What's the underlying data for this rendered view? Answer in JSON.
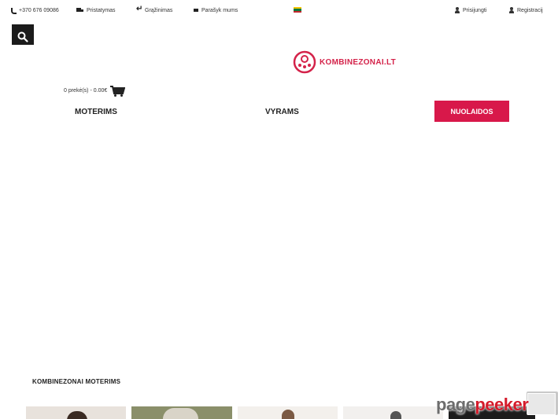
{
  "topbar": {
    "phone": "+370 676 09086",
    "delivery": "Pristatymas",
    "returns": "Grąžinimas",
    "contact": "Parašyk mums",
    "login": "Prisijungti",
    "register": "Registracij"
  },
  "header": {
    "logo_text": "KOMBINEZONAI.LT",
    "cart_text": "0 prekė(s) - 0.00€"
  },
  "nav": {
    "women": "MOTERIMS",
    "men": "VYRAMS",
    "sale": "NUOLAIDOS"
  },
  "section": {
    "title": "KOMBINEZONAI MOTERIMS"
  },
  "watermark": {
    "part1": "page",
    "part2": "peeker"
  },
  "colors": {
    "accent": "#d8184a",
    "brand": "#d4234a",
    "dark": "#1b1b1b"
  },
  "icons": [
    "phone-icon",
    "truck-icon",
    "return-icon",
    "mail-icon",
    "flag-icon",
    "user-icon",
    "user-plus-icon",
    "search-icon",
    "cart-icon"
  ]
}
